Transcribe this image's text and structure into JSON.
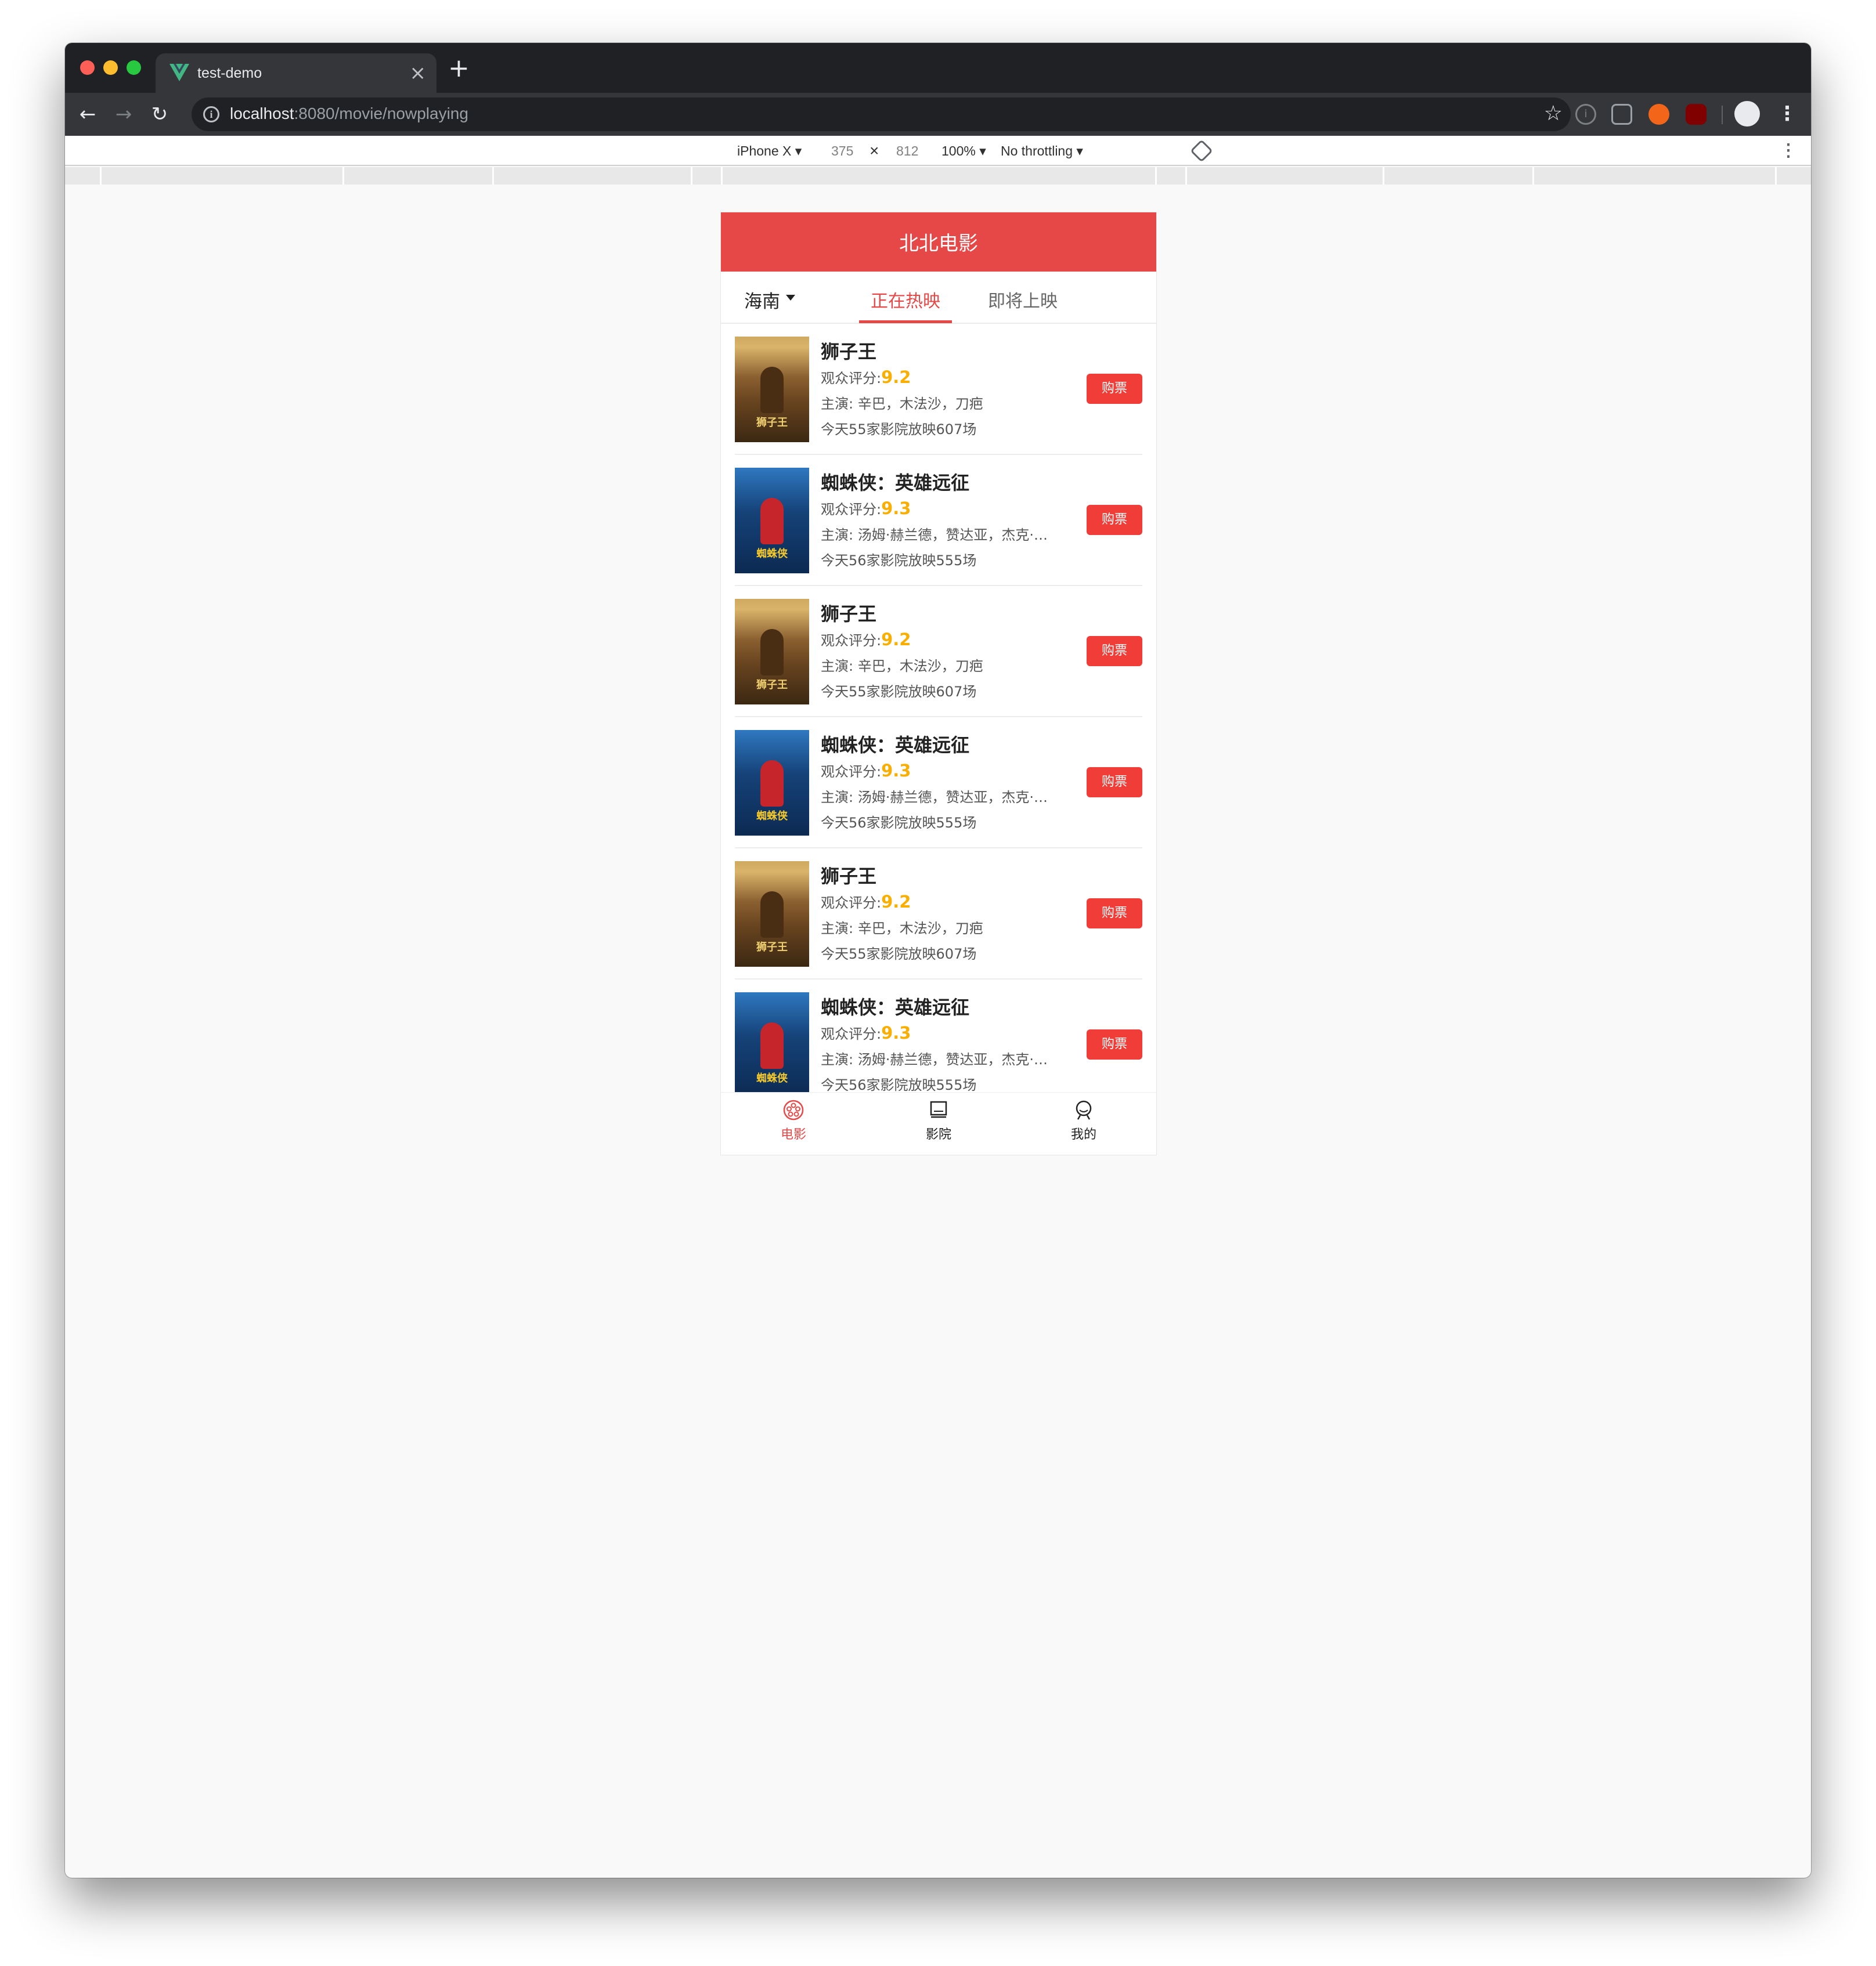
{
  "browser": {
    "tab_title": "test-demo",
    "url_host": "localhost",
    "url_path": ":8080/movie/nowplaying",
    "new_tab_symbol": "+",
    "close_symbol": "×"
  },
  "devtools": {
    "device": "iPhone X",
    "width": "375",
    "times": "×",
    "height": "812",
    "zoom": "100%",
    "throttling": "No throttling"
  },
  "app": {
    "title": "北北电影",
    "city": "海南",
    "tabs": [
      {
        "label": "正在热映",
        "active": true
      },
      {
        "label": "即将上映",
        "active": false
      }
    ],
    "score_prefix": "观众评分:",
    "buy_label": "购票",
    "movies": [
      {
        "title": "狮子王",
        "score": "9.2",
        "actors": "主演: 辛巴，木法沙，刀疤",
        "shows": "今天55家影院放映607场",
        "poster": "lion",
        "poster_text": "狮子王"
      },
      {
        "title": "蜘蛛侠：英雄远征",
        "score": "9.3",
        "actors": "主演: 汤姆·赫兰德，赞达亚，杰克·吉伦哈尔",
        "shows": "今天56家影院放映555场",
        "poster": "spider",
        "poster_text": "蜘蛛侠"
      },
      {
        "title": "狮子王",
        "score": "9.2",
        "actors": "主演: 辛巴，木法沙，刀疤",
        "shows": "今天55家影院放映607场",
        "poster": "lion",
        "poster_text": "狮子王"
      },
      {
        "title": "蜘蛛侠：英雄远征",
        "score": "9.3",
        "actors": "主演: 汤姆·赫兰德，赞达亚，杰克·吉伦哈尔",
        "shows": "今天56家影院放映555场",
        "poster": "spider",
        "poster_text": "蜘蛛侠"
      },
      {
        "title": "狮子王",
        "score": "9.2",
        "actors": "主演: 辛巴，木法沙，刀疤",
        "shows": "今天55家影院放映607场",
        "poster": "lion",
        "poster_text": "狮子王"
      },
      {
        "title": "蜘蛛侠：英雄远征",
        "score": "9.3",
        "actors": "主演: 汤姆·赫兰德，赞达亚，杰克·吉伦哈尔",
        "shows": "今天56家影院放映555场",
        "poster": "spider",
        "poster_text": "蜘蛛侠"
      }
    ],
    "bottom_nav": [
      {
        "label": "电影",
        "icon": "film-reel-icon",
        "active": true
      },
      {
        "label": "影院",
        "icon": "cinema-screen-icon",
        "active": false
      },
      {
        "label": "我的",
        "icon": "user-profile-icon",
        "active": false
      }
    ],
    "colors": {
      "brand_red": "#e54847",
      "score_gold": "#faaf00",
      "buy_red": "#f03d37"
    }
  }
}
